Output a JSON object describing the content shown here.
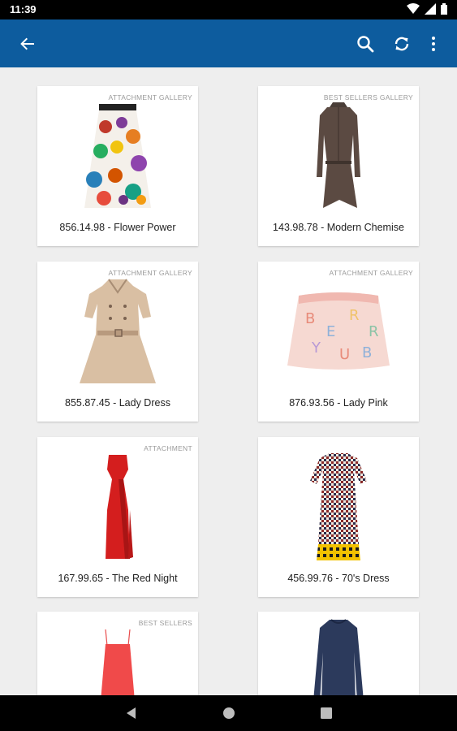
{
  "status_bar": {
    "time": "11:39",
    "icons": [
      "wifi-icon",
      "signal-icon",
      "battery-icon"
    ]
  },
  "app_bar": {
    "background": "#0d5c9e",
    "icons": [
      "back-arrow-icon",
      "search-icon",
      "refresh-icon",
      "more-vert-icon"
    ]
  },
  "products": [
    {
      "tag": "ATTACHMENT GALLERY",
      "label": "856.14.98 - Flower Power"
    },
    {
      "tag": "BEST SELLERS GALLERY",
      "label": "143.98.78 - Modern Chemise"
    },
    {
      "tag": "ATTACHMENT GALLERY",
      "label": "855.87.45 - Lady Dress"
    },
    {
      "tag": "ATTACHMENT GALLERY",
      "label": "876.93.56 - Lady Pink"
    },
    {
      "tag": "ATTACHMENT",
      "label": "167.99.65 - The Red Night"
    },
    {
      "tag": "",
      "label": "456.99.76 - 70's Dress"
    },
    {
      "tag": "BEST SELLERS",
      "label": ""
    },
    {
      "tag": "",
      "label": ""
    }
  ],
  "nav_bar": {
    "icons": [
      "back-triangle-icon",
      "home-circle-icon",
      "recents-square-icon"
    ]
  }
}
